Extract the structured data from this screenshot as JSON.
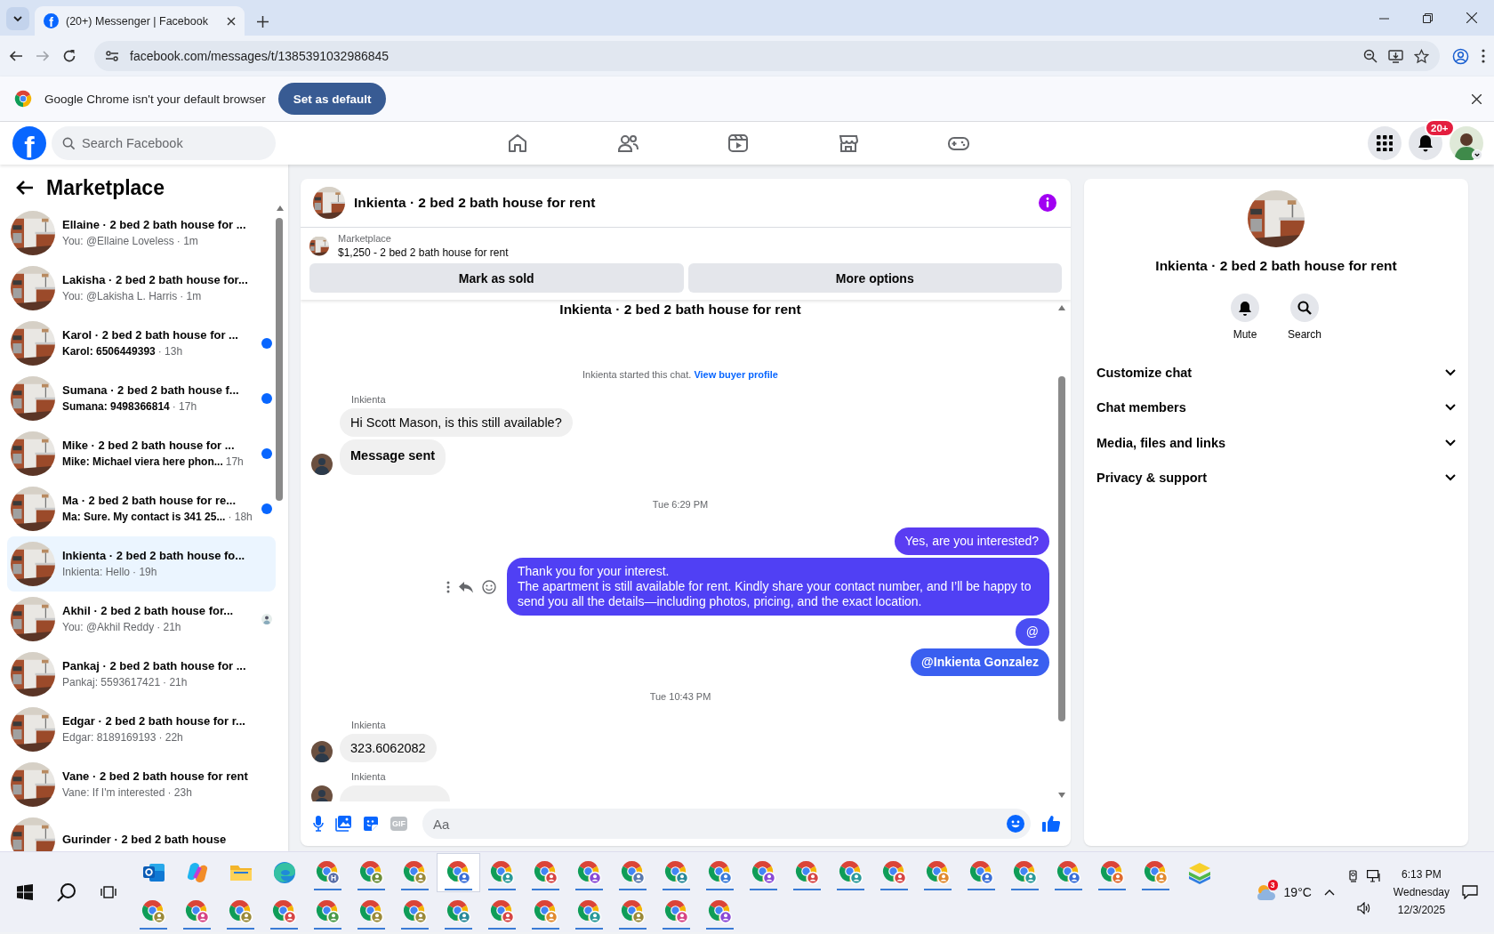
{
  "browser": {
    "tab": {
      "favicon_letter": "f",
      "title": "(20+) Messenger | Facebook"
    },
    "url": "facebook.com/messages/t/1385391032986845",
    "infobar": {
      "text": "Google Chrome isn't your default browser",
      "button": "Set as default"
    }
  },
  "facebook_header": {
    "logo": "f",
    "search": {
      "placeholder": "Search Facebook"
    },
    "nav": [
      {
        "kind": "home",
        "selected": false
      },
      {
        "kind": "friends",
        "selected": false
      },
      {
        "kind": "video",
        "selected": false
      },
      {
        "kind": "marketplace",
        "selected": false
      },
      {
        "kind": "gaming",
        "selected": false
      }
    ],
    "notification_badge": "20+"
  },
  "sidebar": {
    "title": "Marketplace",
    "conversations": [
      {
        "title": "Ellaine · 2 bed 2 bath house for ...",
        "preview": "You: @Ellaine Loveless",
        "time": "· 1m",
        "unread": false,
        "seen": false,
        "selected": false
      },
      {
        "title": "Lakisha · 2 bed 2 bath house for...",
        "preview": "You: @Lakisha L. Harris",
        "time": "· 1m",
        "unread": false,
        "seen": false,
        "selected": false
      },
      {
        "title": "Karol · 2 bed 2 bath house for ...",
        "preview": "Karol: 6506449393",
        "time": "· 13h",
        "unread": true,
        "seen": false,
        "selected": false
      },
      {
        "title": "Sumana · 2 bed 2 bath house f...",
        "preview": "Sumana: 9498366814",
        "time": "· 17h",
        "unread": true,
        "seen": false,
        "selected": false
      },
      {
        "title": "Mike · 2 bed 2 bath house for ...",
        "preview": "Mike: Michael viera here phon...",
        "time": "17h",
        "unread": true,
        "seen": false,
        "selected": false
      },
      {
        "title": "Ma · 2 bed 2 bath house for re...",
        "preview": "Ma: Sure. My contact is 341 25...",
        "time": "· 18h",
        "unread": true,
        "seen": false,
        "selected": false
      },
      {
        "title": "Inkienta · 2 bed 2 bath house fo...",
        "preview": "Inkienta: Hello",
        "time": "· 19h",
        "unread": false,
        "seen": false,
        "selected": true
      },
      {
        "title": "Akhil · 2 bed 2 bath house for...",
        "preview": "You: @Akhil Reddy",
        "time": "· 21h",
        "unread": false,
        "seen": true,
        "selected": false
      },
      {
        "title": "Pankaj · 2 bed 2 bath house for ...",
        "preview": "Pankaj: 5593617421",
        "time": "· 21h",
        "unread": false,
        "seen": false,
        "selected": false
      },
      {
        "title": "Edgar · 2 bed 2 bath house for r...",
        "preview": "Edgar: 8189169193",
        "time": "· 22h",
        "unread": false,
        "seen": false,
        "selected": false
      },
      {
        "title": "Vane · 2 bed 2 bath house for rent",
        "preview": "Vane: If I'm interested",
        "time": "· 23h",
        "unread": false,
        "seen": false,
        "selected": false
      },
      {
        "title": "Gurinder · 2 bed 2 bath house",
        "unread": false,
        "seen": false,
        "selected": false
      }
    ]
  },
  "chat": {
    "title": "Inkienta · 2 bed 2 bath house for rent",
    "listing": {
      "label": "Marketplace",
      "price_title": "$1,250 - 2 bed 2 bath house for rent"
    },
    "actions": [
      "Mark as sold",
      "More options"
    ],
    "intro_title": "Inkienta · 2 bed 2 bath house for rent",
    "intro": {
      "text": "Inkienta started this chat.",
      "link": "View buyer profile"
    },
    "messages": [
      {
        "kind": "incoming",
        "sender": "Inkienta",
        "bubbles": [
          {
            "text": "Hi Scott Mason, is this still available?",
            "bold": false
          },
          {
            "text": "Message sent",
            "bold": true
          }
        ]
      },
      {
        "kind": "timestamp",
        "text": "Tue 6:29 PM"
      },
      {
        "kind": "outgoing",
        "bubbles": [
          {
            "text": "Yes, are you interested?",
            "bold": false,
            "hover": false
          },
          {
            "text": "Thank you for your interest.\nThe apartment is still available for rent. Kindly share your contact number, and I’ll be happy to send you all the details—including photos, pricing, and the exact location.",
            "bold": false,
            "hover": true
          },
          {
            "text": "@",
            "bold": false,
            "hover": false
          },
          {
            "text": "@Inkienta Gonzalez",
            "bold": true,
            "hover": false
          }
        ]
      },
      {
        "kind": "timestamp",
        "text": "Tue 10:43 PM"
      },
      {
        "kind": "incoming",
        "sender": "Inkienta",
        "bubbles": [
          {
            "text": "323.6062082",
            "bold": false
          }
        ]
      },
      {
        "kind": "incoming",
        "sender": "Inkienta",
        "cut_off": true
      }
    ],
    "composer": {
      "gif_label": "GIF",
      "placeholder": "Aa"
    }
  },
  "details": {
    "title": "Inkienta · 2 bed 2 bath house for rent",
    "actions": [
      {
        "kind": "bell",
        "label": "Mute"
      },
      {
        "kind": "search",
        "label": "Search"
      }
    ],
    "sections": [
      {
        "label": "Customize chat",
        "expanded": false
      },
      {
        "label": "Chat members",
        "expanded": false
      },
      {
        "label": "Media, files and links",
        "expanded": false
      },
      {
        "label": "Privacy & support",
        "expanded": false
      }
    ]
  },
  "taskbar": {
    "rows": [
      [
        {
          "kind": "mail",
          "running": false,
          "selected": false
        },
        {
          "kind": "assistant",
          "running": false,
          "selected": false
        },
        {
          "kind": "folder",
          "running": false,
          "selected": false
        },
        {
          "kind": "edge",
          "running": false,
          "selected": false
        },
        {
          "kind": "chrome",
          "color": "#5b6fa8",
          "label": "H",
          "running": true,
          "selected": false
        },
        {
          "kind": "chrome",
          "color": "#6b8e3a",
          "running": true,
          "selected": false
        },
        {
          "kind": "chrome",
          "color": "#9a8a3a",
          "running": true,
          "selected": false
        },
        {
          "kind": "chrome",
          "color": "#3a6fd8",
          "running": true,
          "selected": true
        },
        {
          "kind": "chrome",
          "color": "#2a9a9a",
          "running": true,
          "selected": false
        },
        {
          "kind": "chrome",
          "color": "#d64545",
          "running": true,
          "selected": false
        },
        {
          "kind": "chrome",
          "color": "#8a4ad6",
          "running": true,
          "selected": false
        },
        {
          "kind": "chrome",
          "color": "#5a7ab0",
          "running": true,
          "selected": false
        },
        {
          "kind": "chrome",
          "color": "#2a8a9a",
          "running": true,
          "selected": false
        },
        {
          "kind": "chrome",
          "color": "#3a7ad8",
          "running": true,
          "selected": false
        },
        {
          "kind": "chrome",
          "color": "#8a4ad6",
          "running": true,
          "selected": false
        },
        {
          "kind": "chrome",
          "color": "#d64545",
          "running": true,
          "selected": false
        },
        {
          "kind": "chrome",
          "color": "#2a9a9a",
          "running": true,
          "selected": false
        },
        {
          "kind": "chrome",
          "color": "#d64545",
          "running": true,
          "selected": false
        },
        {
          "kind": "chrome",
          "color": "#e08a30",
          "running": true,
          "selected": false
        },
        {
          "kind": "chrome",
          "color": "#3a6fd8",
          "running": true,
          "selected": false
        },
        {
          "kind": "chrome",
          "color": "#2a9a9a",
          "running": true,
          "selected": false
        },
        {
          "kind": "chrome",
          "color": "#3a6fd8",
          "running": true,
          "selected": false
        },
        {
          "kind": "chrome",
          "color": "#e06a30",
          "running": true,
          "selected": false
        },
        {
          "kind": "chrome",
          "color": "#e08a30",
          "running": true,
          "selected": false
        },
        {
          "kind": "stack",
          "running": false,
          "selected": false
        }
      ],
      [
        {
          "kind": "chrome",
          "color": "#9a8a3a",
          "running": true,
          "selected": false
        },
        {
          "kind": "chrome",
          "color": "#d64585",
          "running": true,
          "selected": false
        },
        {
          "kind": "chrome",
          "color": "#9a8a3a",
          "running": true,
          "selected": false
        },
        {
          "kind": "chrome",
          "color": "#d64545",
          "running": true,
          "selected": false
        },
        {
          "kind": "chrome",
          "color": "#4a9a4a",
          "running": true,
          "selected": false
        },
        {
          "kind": "chrome",
          "color": "#9a8a3a",
          "running": true,
          "selected": false
        },
        {
          "kind": "chrome",
          "color": "#9a8a3a",
          "running": true,
          "selected": false
        },
        {
          "kind": "chrome",
          "color": "#2a8a9a",
          "running": true,
          "selected": false
        },
        {
          "kind": "chrome",
          "color": "#d64545",
          "running": true,
          "selected": false
        },
        {
          "kind": "chrome",
          "color": "#e08a30",
          "running": true,
          "selected": false
        },
        {
          "kind": "chrome",
          "color": "#2a9a9a",
          "running": true,
          "selected": false
        },
        {
          "kind": "chrome",
          "color": "#9a8a3a",
          "running": true,
          "selected": false
        },
        {
          "kind": "chrome",
          "color": "#d64585",
          "running": true,
          "selected": false
        },
        {
          "kind": "chrome",
          "color": "#8a4ad6",
          "running": true,
          "selected": false
        }
      ]
    ],
    "weather": {
      "badge": "3",
      "temperature": "19°C"
    },
    "clock": {
      "time": "6:13 PM",
      "day": "Wednesday",
      "date": "12/3/2025"
    }
  }
}
